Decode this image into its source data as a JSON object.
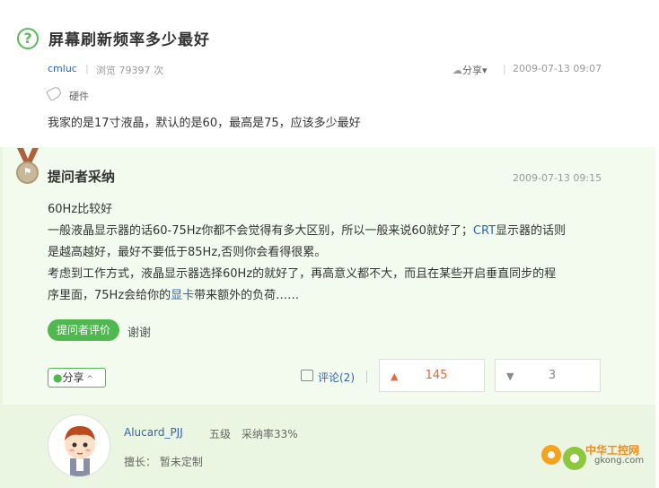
{
  "question": {
    "icon": "question-circle-icon",
    "icon_glyph": "?",
    "title": "屏幕刷新频率多少最好",
    "author": "cmluc",
    "views": "浏览 79397 次",
    "share": "分享",
    "date": "2009-07-13 09:07",
    "tag": "硬件",
    "body": "我家的是17寸液晶，默认的是60，最高是75，应该多少最好"
  },
  "answer": {
    "title": "提问者采纳",
    "date": "2009-07-13 09:15",
    "lines": [
      "60Hz比较好",
      "一般液晶显示器的话60-75Hz你都不会觉得有多大区别，所以一般来说60就好了；",
      "CRT",
      "显示器的话则",
      "是越高越好，最好不要低于85Hz,否则你会看得很累。",
      "考虑到工作方式，液晶显示器选择60Hz的就好了，再高意义都不大，而且在某些开启垂直同步的程",
      "序里面，75Hz会给你的",
      "显卡",
      "带来额外的负荷……"
    ],
    "eval_button": "提问者评价",
    "thanks": "谢谢",
    "share": "分享",
    "comments": "评论(2)",
    "upvotes": "145",
    "downvotes": "3"
  },
  "user": {
    "name": "Alucard_PJJ",
    "level": "五级",
    "adopt_rate": "采纳率33%",
    "skill": "擅长：  暂未定制"
  },
  "watermark": {
    "title": "中华工控网",
    "site": "gkong.com"
  },
  "colors": {
    "accent_green": "#4fb84f",
    "link_blue": "#2d64b3",
    "vote_orange": "#e0683b",
    "answer_bg": "#f3fbee"
  }
}
